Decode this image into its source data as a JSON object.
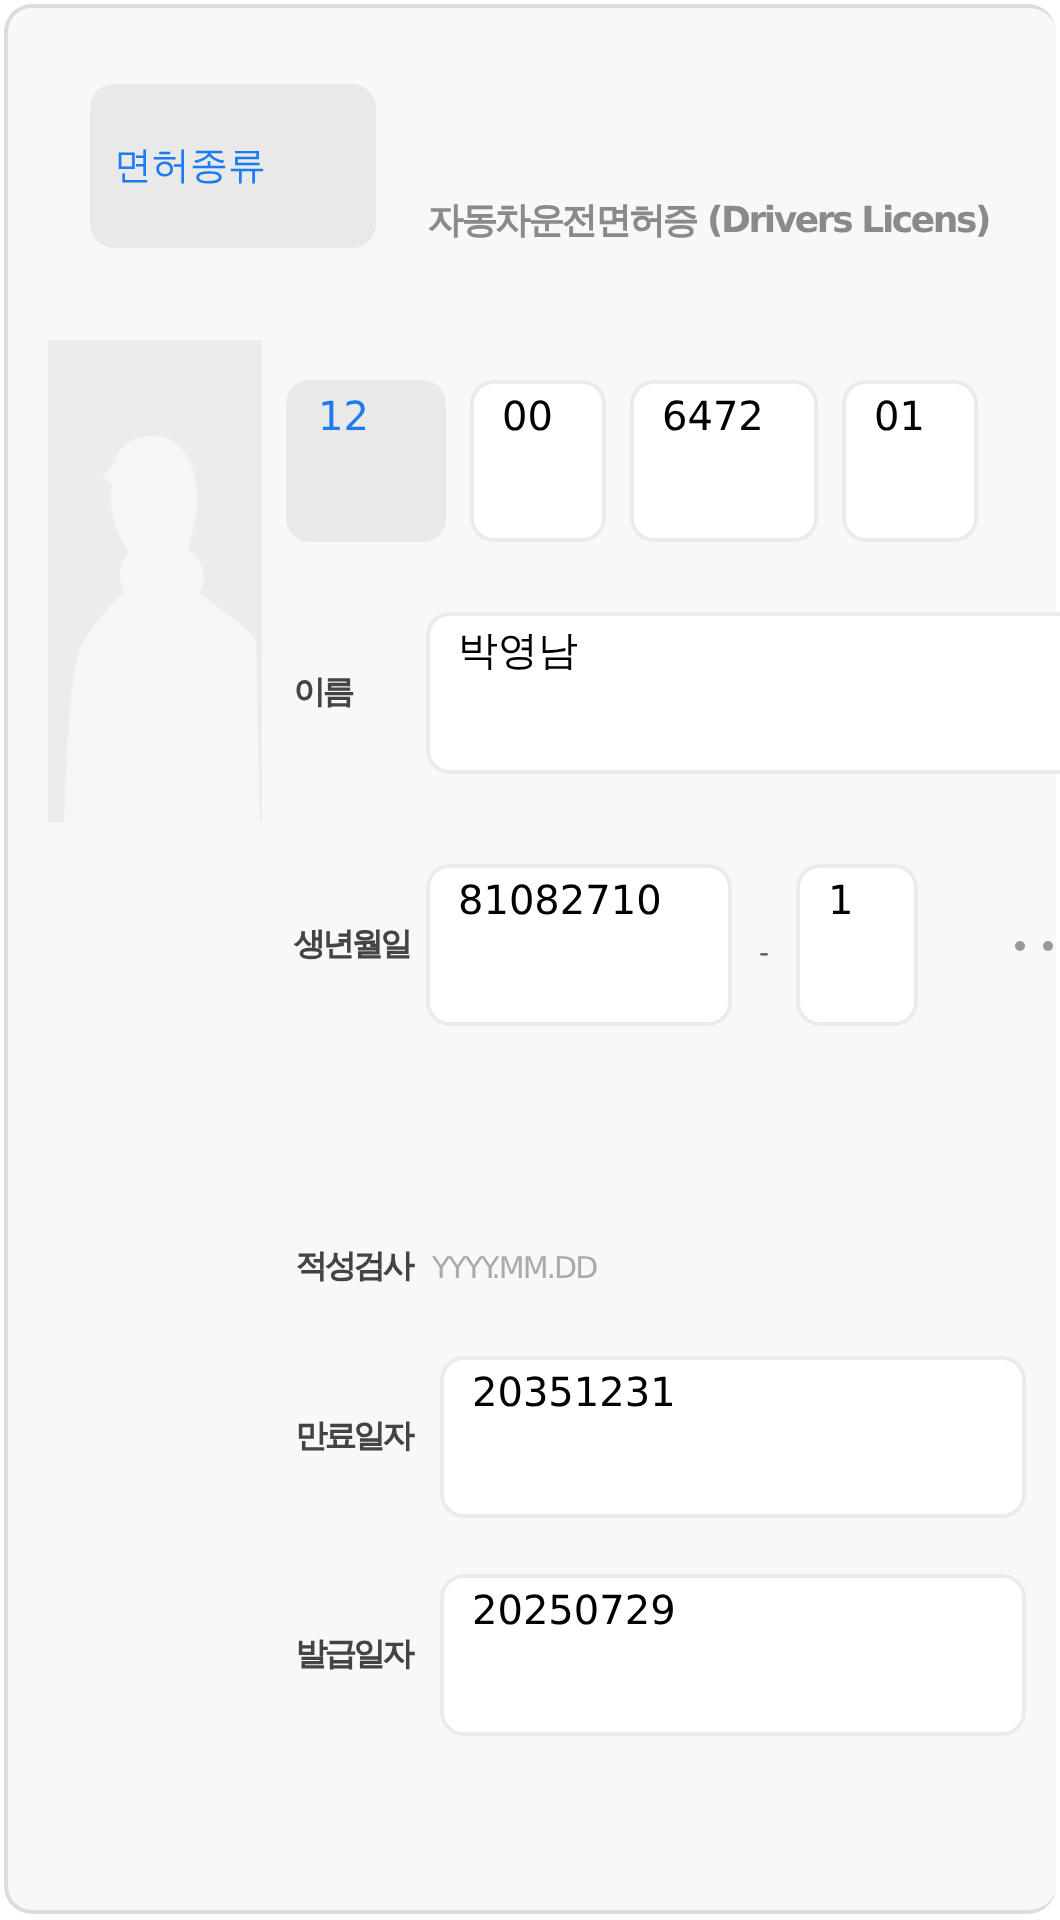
{
  "license_type": {
    "label": "면허종류"
  },
  "title": "자동차운전면허증 (Drivers Licens)",
  "license_number": [
    {
      "value": "12",
      "disabled": true
    },
    {
      "value": "00",
      "disabled": false
    },
    {
      "value": "6472",
      "disabled": false
    },
    {
      "value": "01",
      "disabled": false
    }
  ],
  "name": {
    "label": "이름",
    "value": "박영남"
  },
  "birth": {
    "label": "생년월일",
    "value": "81082710",
    "separator": "-",
    "suffix": "1"
  },
  "aptitude_test": {
    "label": "적성검사",
    "placeholder": "YYYY.MM.DD"
  },
  "expiry": {
    "label": "만료일자",
    "value": "20351231"
  },
  "issue": {
    "label": "발급일자",
    "value": "20250729"
  }
}
